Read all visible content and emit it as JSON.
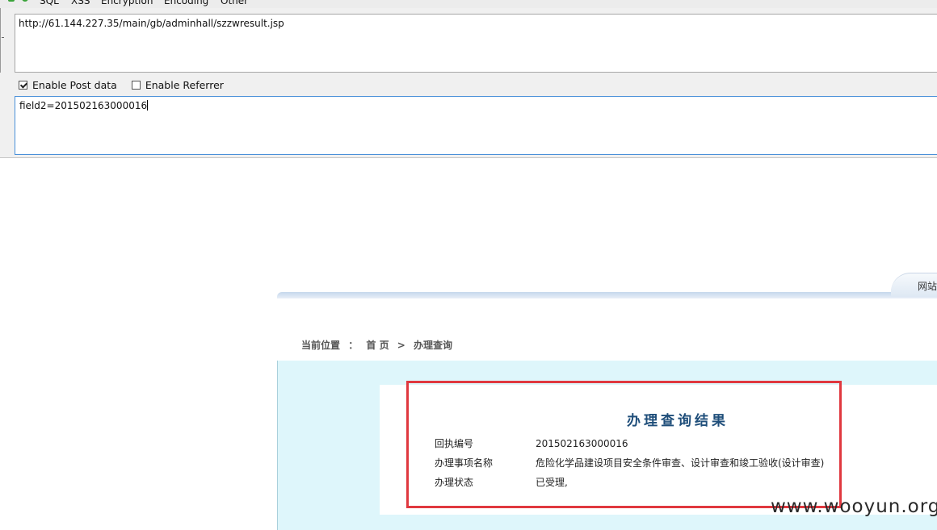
{
  "hackbar": {
    "menus": [
      "SQL",
      "XSS",
      "Encryption",
      "Encoding",
      "Other"
    ],
    "url_value": "http://61.144.227.35/main/gb/adminhall/szzwresult.jsp",
    "enable_post_label": "Enable Post data",
    "enable_post_checked": true,
    "enable_referrer_label": "Enable Referrer",
    "enable_referrer_checked": false,
    "post_value": "field2=201502163000016"
  },
  "site": {
    "header_tab_text": "网站",
    "breadcrumb": {
      "label": "当前位置",
      "separator": "：",
      "home": "首 页",
      "arrow": ">",
      "current": "办理查询"
    },
    "result": {
      "title": "办理查询结果",
      "rows": [
        {
          "label": "回执编号",
          "value": "201502163000016"
        },
        {
          "label": "办理事项名称",
          "value": "危险化学品建设项目安全条件审查、设计审查和竣工验收(设计审查)"
        },
        {
          "label": "办理状态",
          "value": "已受理,"
        }
      ]
    }
  },
  "watermark": "www.wooyun.org",
  "colors": {
    "highlight_border": "#e0383f",
    "result_title": "#1f4e7a",
    "content_bg": "#def6fb",
    "post_border": "#4a90d9"
  }
}
